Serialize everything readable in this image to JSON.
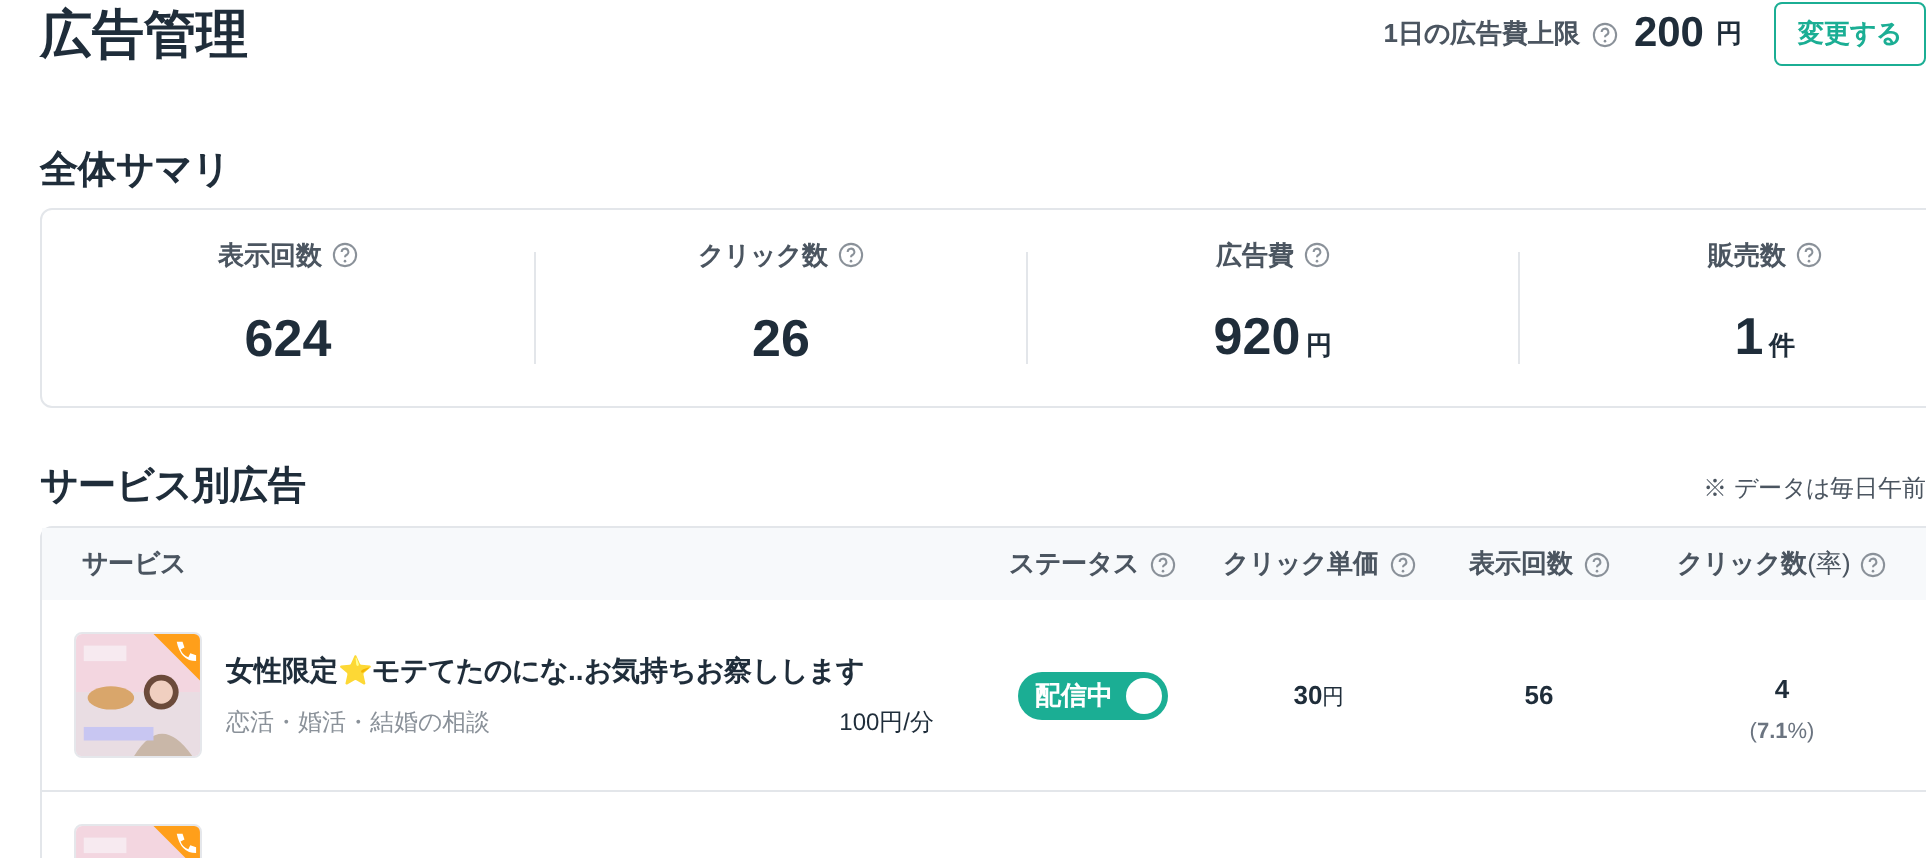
{
  "page_title": "広告管理",
  "budget": {
    "label": "1日の広告費上限",
    "value": "200",
    "unit": "円",
    "button": "変更する"
  },
  "summary": {
    "title": "全体サマリ",
    "metrics": [
      {
        "label": "表示回数",
        "value": "624"
      },
      {
        "label": "クリック数",
        "value": "26"
      },
      {
        "label": "広告費",
        "value": "920",
        "unit": "円"
      },
      {
        "label": "販売数",
        "value": "1",
        "unit": "件"
      }
    ]
  },
  "services": {
    "title": "サービス別広告",
    "notice": "※ データは毎日午前",
    "columns": [
      {
        "label": "サービス",
        "kind": "plain"
      },
      {
        "label": "ステータス",
        "kind": "help"
      },
      {
        "label": "クリック単価",
        "kind": "help"
      },
      {
        "label": "表示回数",
        "kind": "help"
      },
      {
        "label": "クリック数",
        "suffix": "(率)",
        "kind": "help"
      }
    ],
    "rows": [
      {
        "title": "女性限定⭐モテてたのにな..お気持ちお察しします",
        "category": "恋活・婚活・結婚の相談",
        "price": "100円/分",
        "status": {
          "label": "配信中",
          "on": true
        },
        "cpc": "30",
        "cpc_unit": "円",
        "impressions": "56",
        "clicks": "4",
        "rate_open": "(",
        "rate": "7.1",
        "rate_unit": "%",
        "rate_close": ")"
      }
    ]
  }
}
